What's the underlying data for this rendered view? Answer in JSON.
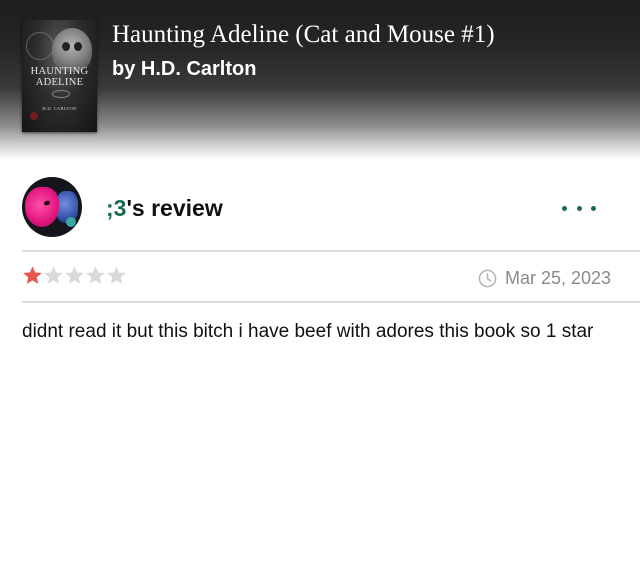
{
  "book": {
    "title": "Haunting Adeline (Cat and Mouse #1)",
    "author": "by H.D. Carlton",
    "cover": {
      "title_line1": "HAUNTING",
      "title_line2": "ADELINE",
      "author": "H.D. CARLTON"
    }
  },
  "review": {
    "reviewer": ";3",
    "title_suffix": "'s review",
    "rating": 1,
    "max_rating": 5,
    "date": "Mar 25, 2023",
    "text": "didnt read it but this bitch i have beef with adores this book so 1 star"
  },
  "colors": {
    "accent": "#1b6b52",
    "star_filled": "#e8554e",
    "star_empty": "#d9d9d9",
    "muted_text": "#8a8a8a",
    "divider": "#dcdcdc"
  },
  "icons": {
    "more": "more-horizontal-icon",
    "clock": "clock-icon",
    "star": "star-icon"
  }
}
